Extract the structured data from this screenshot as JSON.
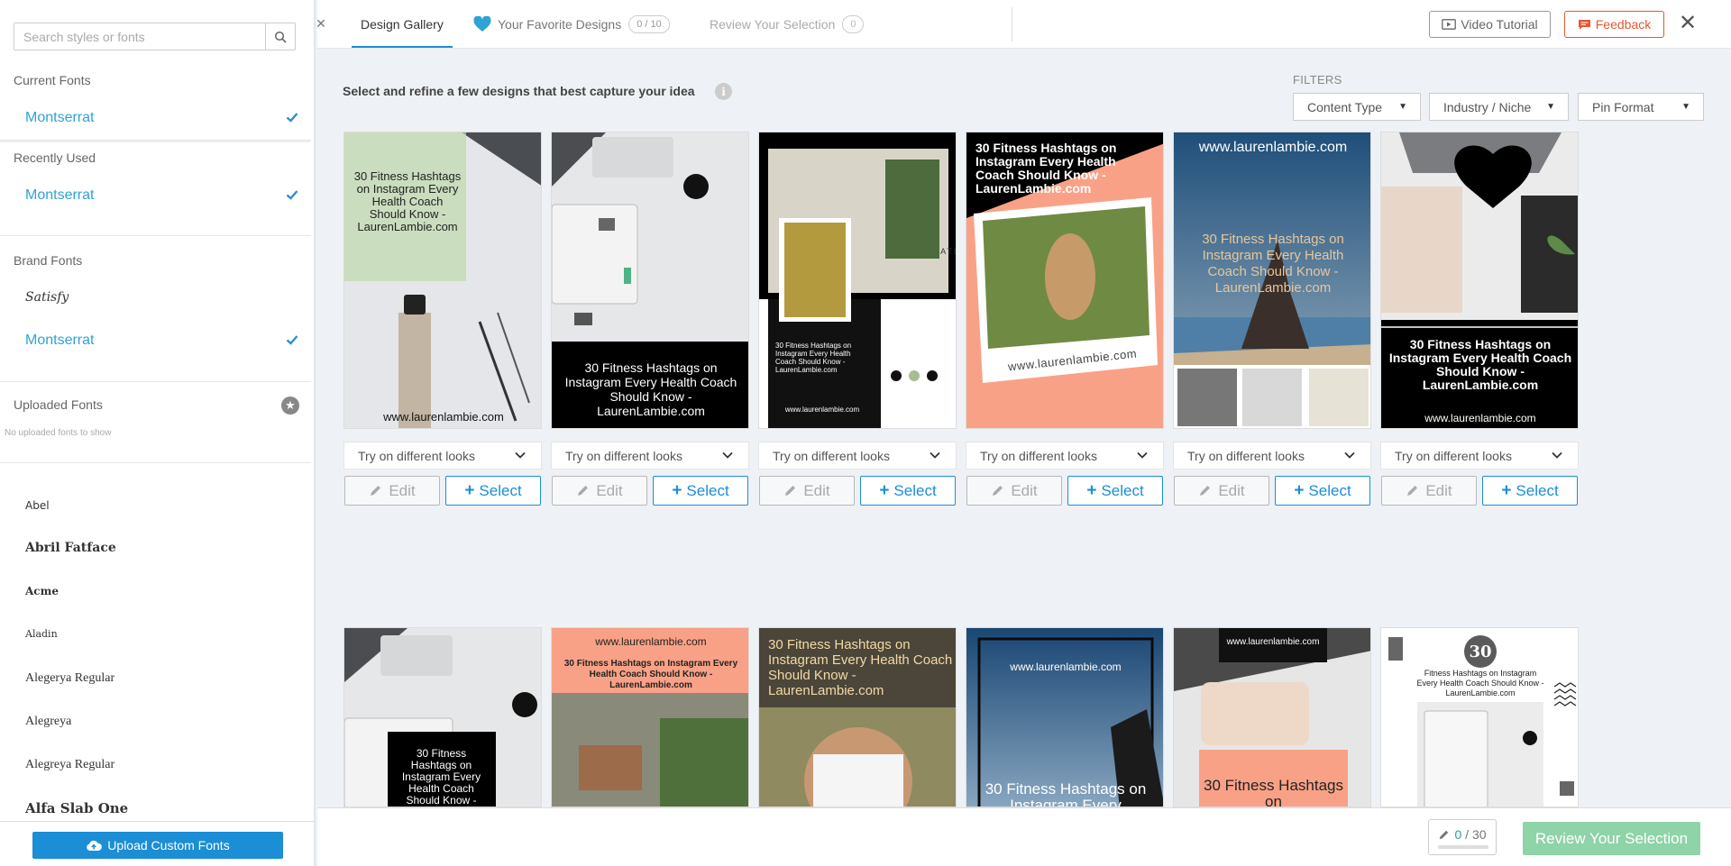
{
  "sidebar": {
    "search_placeholder": "Search styles or fonts",
    "sections": {
      "current": "Current Fonts",
      "recent": "Recently Used",
      "brand": "Brand Fonts",
      "uploaded": "Uploaded Fonts"
    },
    "current_font": "Montserrat",
    "recent_font": "Montserrat",
    "brand_fonts": [
      "Satisfy",
      "Montserrat"
    ],
    "no_uploaded": "No uploaded fonts to show",
    "font_list": [
      "Abel",
      "Abril Fatface",
      "Acme",
      "Aladin",
      "Alegerya Regular",
      "Alegreya",
      "Alegreya Regular",
      "Alfa Slab One"
    ],
    "upload_label": "Upload Custom Fonts"
  },
  "topnav": {
    "tab_gallery": "Design Gallery",
    "tab_favorites": "Your Favorite Designs",
    "favorites_count": "0 / 10",
    "tab_review": "Review Your Selection",
    "review_count": "0",
    "video_tutorial": "Video Tutorial",
    "feedback": "Feedback"
  },
  "main": {
    "instruction": "Select and refine a few designs that best capture your idea",
    "filters_label": "FILTERS",
    "filters": [
      "Content Type",
      "Industry / Niche",
      "Pin Format"
    ],
    "looks_label": "Try on different looks",
    "edit_label": "Edit",
    "select_label": "Select"
  },
  "cards": {
    "row1": [
      {
        "title": "30 Fitness Hashtags on Instagram Every Health Coach Should Know - LaurenLambie.com",
        "url": "www.laurenlambie.com"
      },
      {
        "title": "30 Fitness Hashtags on Instagram Every Health Coach Should Know - LaurenLambie.com"
      },
      {
        "title": "30 Fitness Hashtags on Instagram Every Health Coach Should Know - LaurenLambie.com",
        "url": "www.laurenlambie.com",
        "atlas": "ATLAS"
      },
      {
        "title": "30 Fitness Hashtags on Instagram Every Health Coach Should Know - LaurenLambie.com",
        "url": "www.laurenlambie.com"
      },
      {
        "title": "30 Fitness Hashtags on Instagram Every Health Coach Should Know - LaurenLambie.com",
        "url": "www.laurenlambie.com"
      },
      {
        "title": "30 Fitness Hashtags on Instagram Every Health Coach Should Know - LaurenLambie.com",
        "url": "www.laurenlambie.com"
      }
    ],
    "row2": [
      {
        "title": "30 Fitness Hashtags on Instagram Every Health Coach Should Know -"
      },
      {
        "title": "30 Fitness Hashtags on Instagram Every Health Coach Should Know - LaurenLambie.com",
        "url": "www.laurenlambie.com"
      },
      {
        "title": "30 Fitness Hashtags on Instagram Every Health Coach Should Know - LaurenLambie.com"
      },
      {
        "title": "30 Fitness Hashtags on Instagram Every",
        "url": "www.laurenlambie.com"
      },
      {
        "title": "30 Fitness Hashtags on",
        "url": "www.laurenlambie.com"
      },
      {
        "title": "Fitness Hashtags on Instagram Every Health Coach Should Know - LaurenLambie.com",
        "number": "30"
      }
    ]
  },
  "bottom": {
    "count_current": "0",
    "count_sep": " / ",
    "count_total": "30",
    "review_button": "Review Your Selection"
  },
  "colors": {
    "accent": "#1b8ed6",
    "link": "#2ea3d4",
    "feedback": "#e4572e",
    "review_button": "#8fd3a8",
    "peach": "#f9a187"
  }
}
